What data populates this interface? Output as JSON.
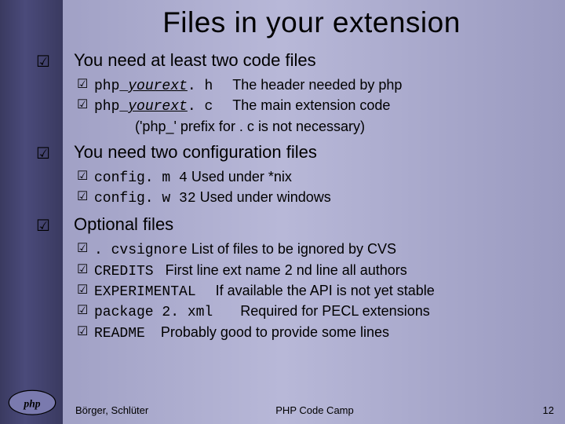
{
  "title": "Files in your extension",
  "sections": [
    {
      "heading": "You need at least two code files",
      "items": [
        {
          "name_prefix": "php_",
          "name_mid": "yourext",
          "name_suffix": ". h",
          "desc": "The header needed by php"
        },
        {
          "name_prefix": "php_",
          "name_mid": "yourext",
          "name_suffix": ". c",
          "desc": "The main extension code"
        }
      ],
      "note": "('php_' prefix for . c is not necessary)"
    },
    {
      "heading": "You need two configuration files",
      "items": [
        {
          "name": "config. m 4",
          "desc": "Used under *nix"
        },
        {
          "name": "config. w 32",
          "desc": "Used under windows"
        }
      ]
    },
    {
      "heading": "Optional files",
      "items": [
        {
          "name": ". cvsignore",
          "desc": "List of files to be ignored by CVS"
        },
        {
          "name": "CREDITS",
          "desc": "First line ext name 2 nd line all authors"
        },
        {
          "name": "EXPERIMENTAL",
          "desc": "If available the API is not yet stable"
        },
        {
          "name": "package 2. xml",
          "desc": "Required for PECL extensions"
        },
        {
          "name": "README",
          "desc": "Probably good to provide some lines"
        }
      ]
    }
  ],
  "footer": {
    "left": "Börger, Schlüter",
    "center": "PHP Code Camp",
    "right": "12"
  },
  "glyphs": {
    "check": "☑"
  },
  "logo": "php"
}
